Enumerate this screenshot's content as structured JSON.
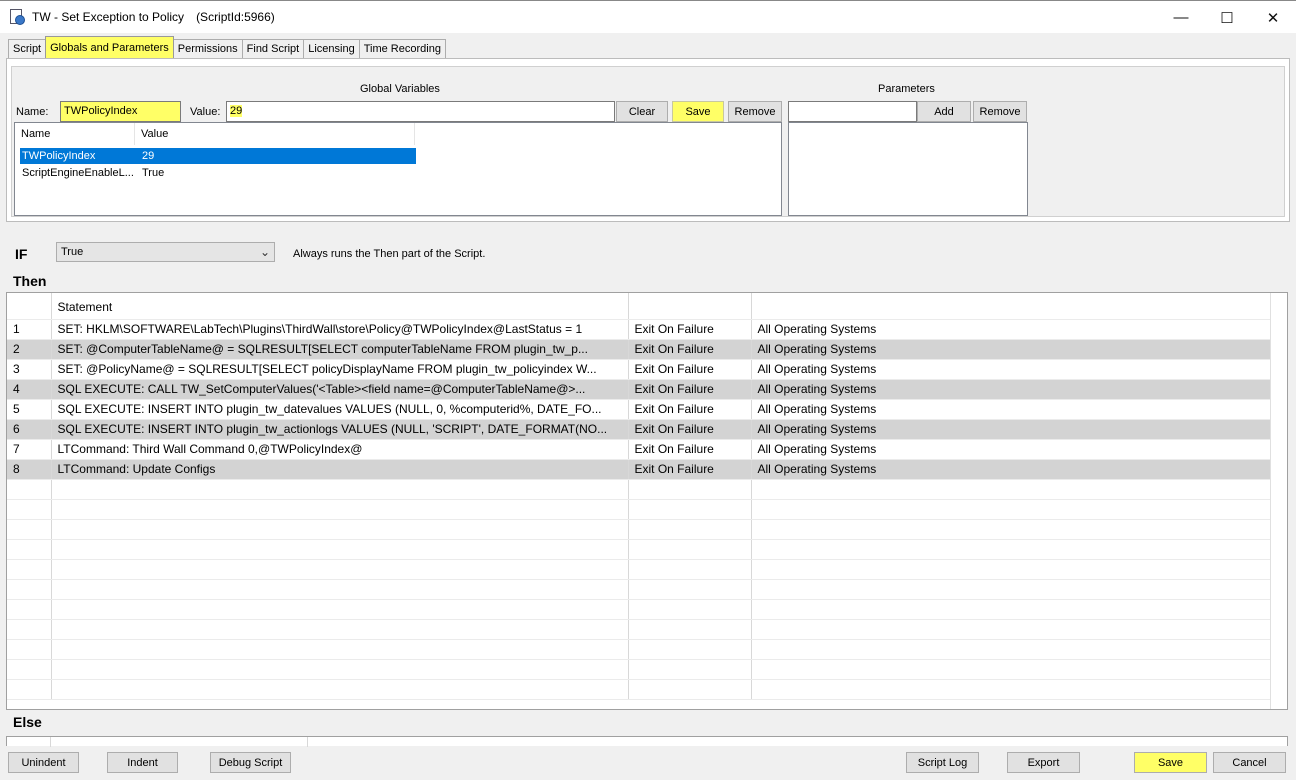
{
  "window": {
    "title": "TW - Set Exception to Policy",
    "script_id": "(ScriptId:5966)",
    "minimize": "—",
    "maximize": "☐",
    "close": "✕"
  },
  "tabs": [
    {
      "label": "Script"
    },
    {
      "label": "Globals and Parameters"
    },
    {
      "label": "Permissions"
    },
    {
      "label": "Find Script"
    },
    {
      "label": "Licensing"
    },
    {
      "label": "Time Recording"
    }
  ],
  "globals": {
    "section_title": "Global Variables",
    "name_label": "Name:",
    "name_value": "TWPolicyIndex",
    "value_label": "Value:",
    "value_value": "29",
    "clear_label": "Clear",
    "save_label": "Save",
    "remove_label": "Remove",
    "columns": [
      "Name",
      "Value"
    ],
    "rows": [
      {
        "name": "TWPolicyIndex",
        "value": "29"
      },
      {
        "name": "ScriptEngineEnableL...",
        "value": "True"
      }
    ]
  },
  "parameters": {
    "section_title": "Parameters",
    "input_value": "",
    "add_label": "Add",
    "remove_label": "Remove"
  },
  "condition": {
    "if_label": "IF",
    "selected": "True",
    "description": "Always runs the Then part of the Script.",
    "then_label": "Then",
    "else_label": "Else"
  },
  "statements": {
    "header": "Statement",
    "rows": [
      {
        "num": "1",
        "statement": "SET:  HKLM\\SOFTWARE\\LabTech\\Plugins\\ThirdWall\\store\\Policy@TWPolicyIndex@LastStatus = 1",
        "on_fail": "Exit On Failure",
        "os": "All Operating Systems"
      },
      {
        "num": "2",
        "statement": "SET:  @ComputerTableName@ = SQLRESULT[SELECT computerTableName FROM plugin_tw_p...",
        "on_fail": "Exit On Failure",
        "os": "All Operating Systems"
      },
      {
        "num": "3",
        "statement": "SET:  @PolicyName@ = SQLRESULT[SELECT policyDisplayName FROM plugin_tw_policyindex W...",
        "on_fail": "Exit On Failure",
        "os": "All Operating Systems"
      },
      {
        "num": "4",
        "statement": "SQL EXECUTE: CALL TW_SetComputerValues('<Table><field name=@ComputerTableName@>...",
        "on_fail": "Exit On Failure",
        "os": "All Operating Systems"
      },
      {
        "num": "5",
        "statement": "SQL EXECUTE: INSERT INTO plugin_tw_datevalues VALUES (NULL, 0, %computerid%, DATE_FO...",
        "on_fail": "Exit On Failure",
        "os": "All Operating Systems"
      },
      {
        "num": "6",
        "statement": "SQL EXECUTE: INSERT INTO plugin_tw_actionlogs VALUES (NULL, 'SCRIPT', DATE_FORMAT(NO...",
        "on_fail": "Exit On Failure",
        "os": "All Operating Systems"
      },
      {
        "num": "7",
        "statement": "LTCommand: Third Wall Command 0,@TWPolicyIndex@",
        "on_fail": "Exit On Failure",
        "os": "All Operating Systems"
      },
      {
        "num": "8",
        "statement": "LTCommand: Update Configs",
        "on_fail": "Exit On Failure",
        "os": "All Operating Systems"
      }
    ]
  },
  "footer": {
    "unindent": "Unindent",
    "indent": "Indent",
    "debug": "Debug Script",
    "script_log": "Script Log",
    "export": "Export",
    "save": "Save",
    "cancel": "Cancel"
  },
  "colors": {
    "highlight": "#ffff66",
    "selection": "#0078d7",
    "alt_row": "#d3d3d3"
  }
}
